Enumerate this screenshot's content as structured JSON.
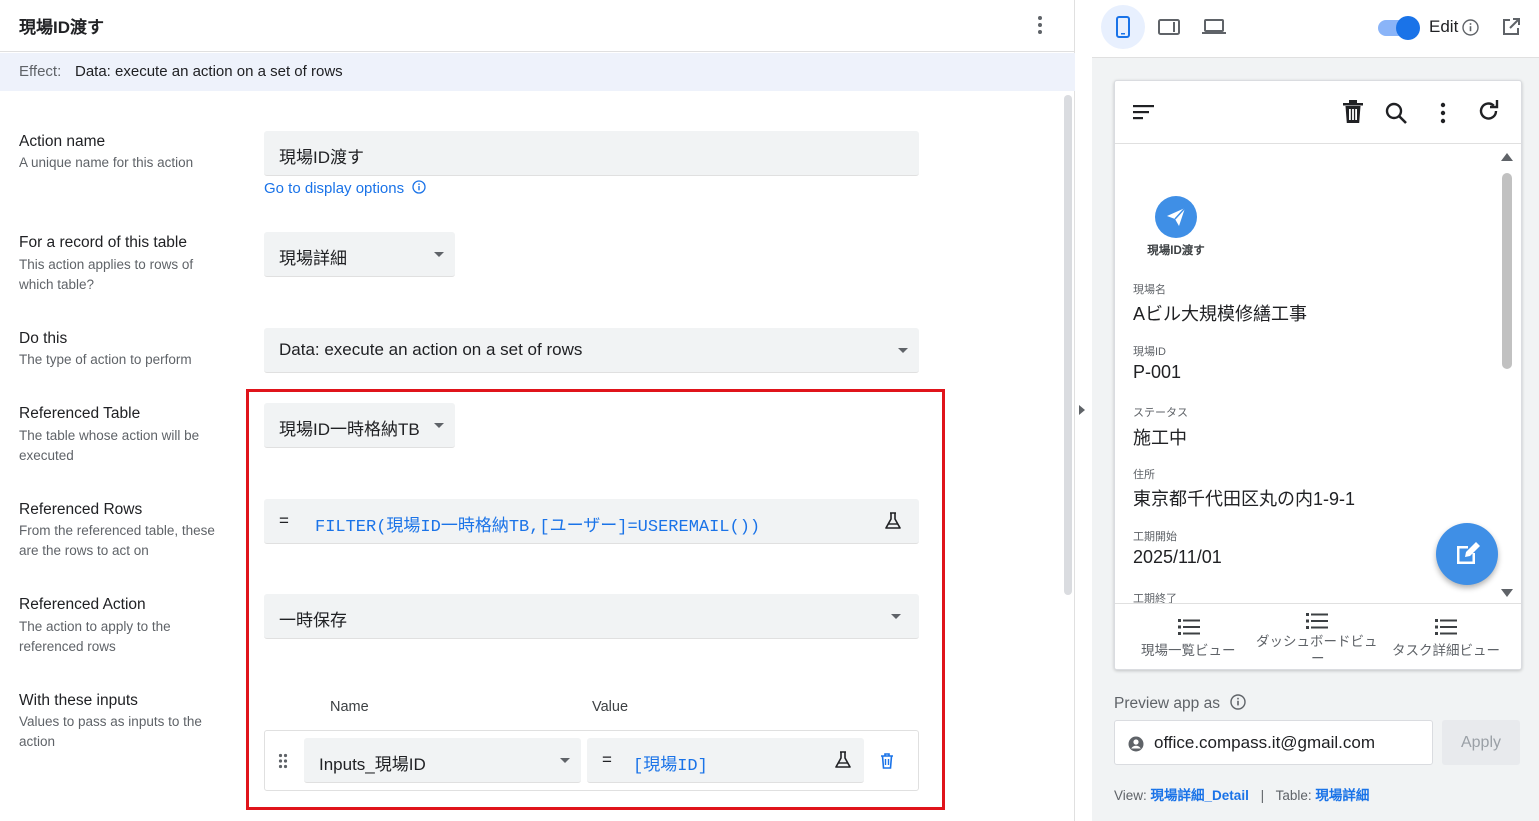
{
  "editor": {
    "title": "現場ID渡す",
    "effect_label": "Effect:",
    "effect_value": "Data: execute an action on a set of rows",
    "action_name": {
      "title": "Action name",
      "desc": "A unique name for this action",
      "value": "現場ID渡す",
      "link": "Go to display options"
    },
    "record_table": {
      "title": "For a record of this table",
      "desc": "This action applies to rows of which table?",
      "value": "現場詳細"
    },
    "do_this": {
      "title": "Do this",
      "desc": "The type of action to perform",
      "value": "Data: execute an action on a set of rows"
    },
    "ref_table": {
      "title": "Referenced Table",
      "desc": "The table whose action will be executed",
      "value": "現場ID一時格納TB"
    },
    "ref_rows": {
      "title": "Referenced Rows",
      "desc": "From the referenced table, these are the rows to act on",
      "eq": "=",
      "expression": "FILTER(現場ID一時格納TB,[ユーザー]=USEREMAIL())"
    },
    "ref_action": {
      "title": "Referenced Action",
      "desc": "The action to apply to the referenced rows",
      "value": "一時保存"
    },
    "inputs": {
      "title": "With these inputs",
      "desc": "Values to pass as inputs to the action",
      "col_name": "Name",
      "col_value": "Value",
      "rows": [
        {
          "name": "Inputs_現場ID",
          "eq": "=",
          "value": "[現場ID]"
        }
      ]
    }
  },
  "preview": {
    "edit_label": "Edit",
    "action_label": "現場ID渡す",
    "fields": [
      {
        "label": "現場名",
        "value": "Aビル大規模修繕工事"
      },
      {
        "label": "現場ID",
        "value": "P-001"
      },
      {
        "label": "ステータス",
        "value": "施工中"
      },
      {
        "label": "住所",
        "value": "東京都千代田区丸の内1-9-1"
      },
      {
        "label": "工期開始",
        "value": "2025/11/01"
      },
      {
        "label": "工期終了",
        "value": ""
      }
    ],
    "nav": [
      {
        "label": "現場一覧ビュー"
      },
      {
        "label_line1": "ダッシュボードビュ",
        "label_line2": "ー"
      },
      {
        "label": "タスク詳細ビュー"
      }
    ],
    "preview_as_label": "Preview app as",
    "email": "office.compass.it@gmail.com",
    "apply_label": "Apply",
    "view_label": "View:",
    "view_value": "現場詳細_Detail",
    "separator": "|",
    "table_label": "Table:",
    "table_value": "現場詳細"
  },
  "colors": {
    "accent": "#1a73e8",
    "highlight_box": "#e0141b",
    "fab": "#3f8fe6"
  }
}
